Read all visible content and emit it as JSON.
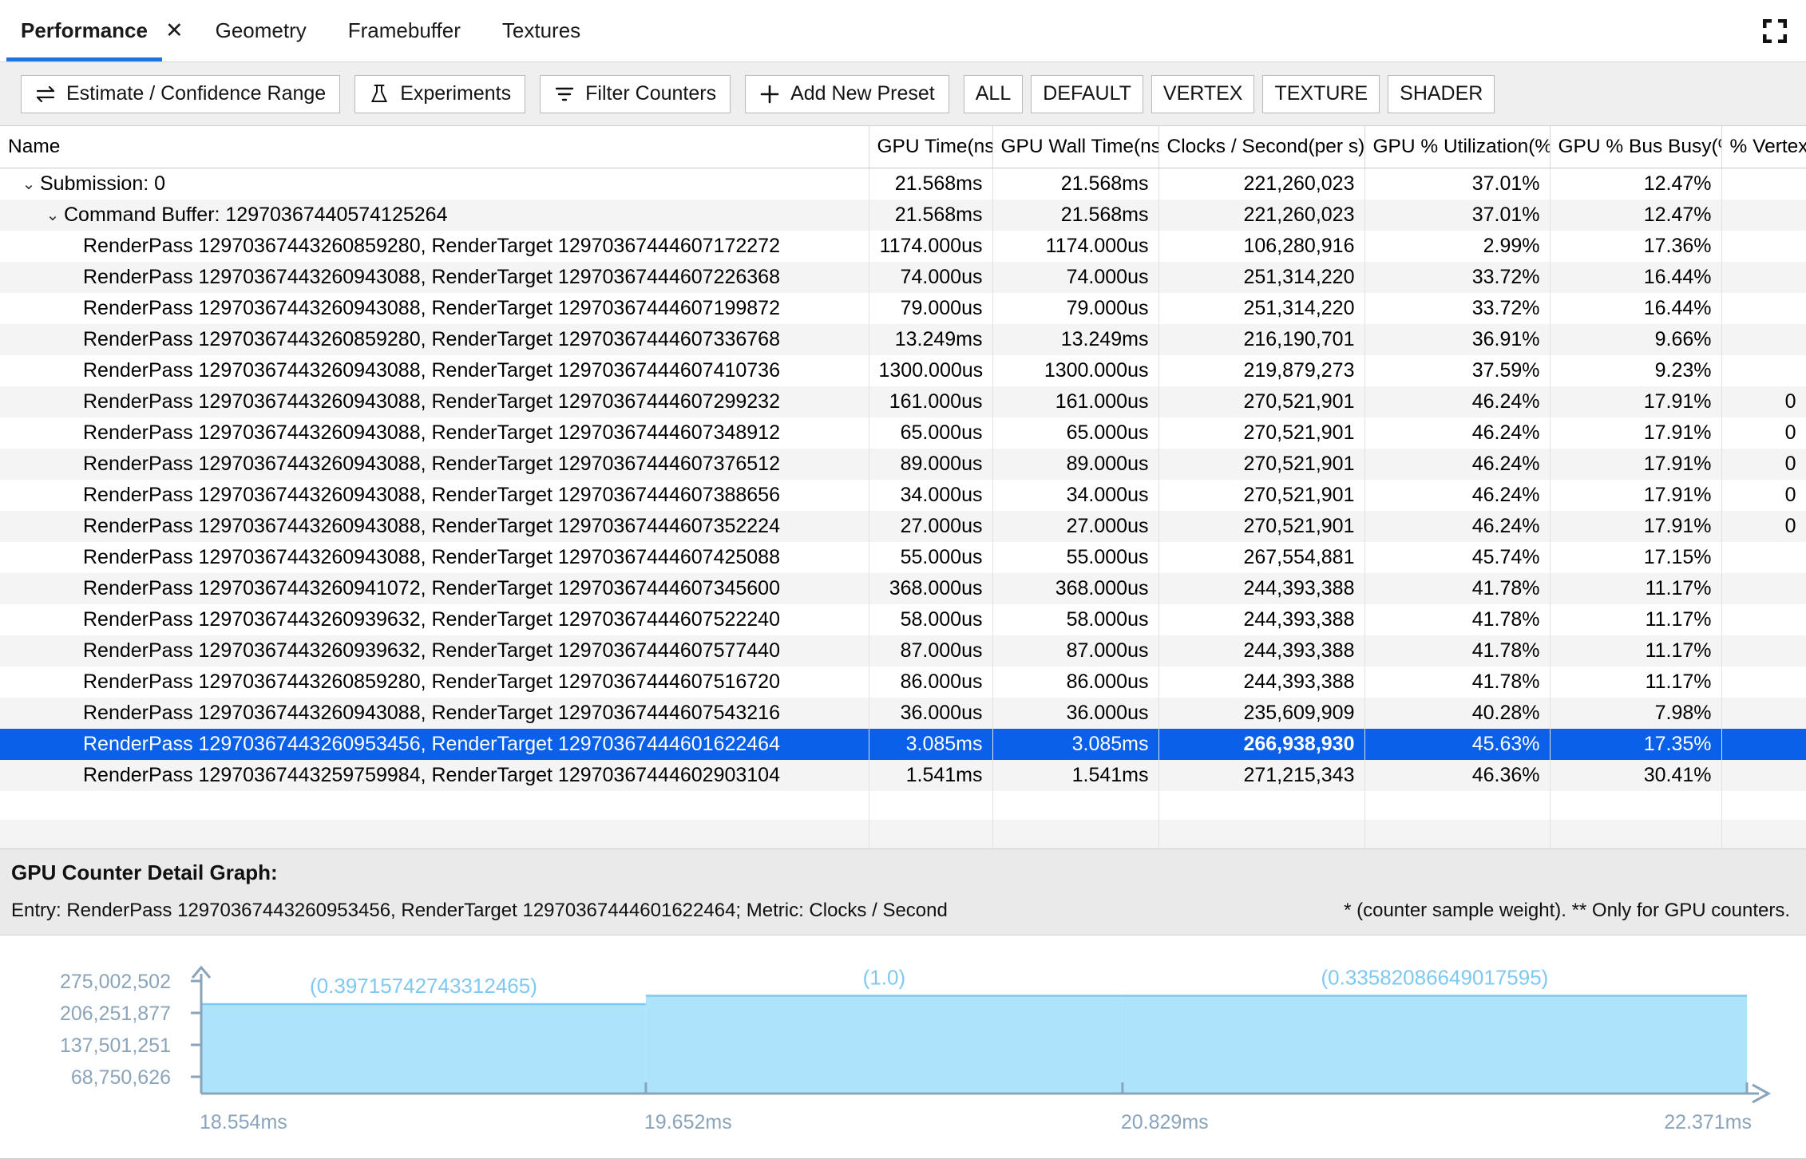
{
  "tabs": [
    {
      "label": "Performance",
      "active": true,
      "closable": true
    },
    {
      "label": "Geometry",
      "active": false,
      "closable": false
    },
    {
      "label": "Framebuffer",
      "active": false,
      "closable": false
    },
    {
      "label": "Textures",
      "active": false,
      "closable": false
    }
  ],
  "tab_close_glyph": "✕",
  "window": {
    "expand_icon": "expand-icon"
  },
  "toolbar": {
    "buttons": [
      {
        "label": "Estimate / Confidence Range",
        "icon": "swap-arrows-icon"
      },
      {
        "label": "Experiments",
        "icon": "flask-icon"
      },
      {
        "label": "Filter Counters",
        "icon": "filter-icon"
      },
      {
        "label": "Add New Preset",
        "icon": "plus-icon"
      }
    ],
    "presets": [
      "ALL",
      "DEFAULT",
      "VERTEX",
      "TEXTURE",
      "SHADER"
    ]
  },
  "table": {
    "columns": [
      "Name",
      "GPU Time(ns)",
      "GPU Wall Time(ns)",
      "Clocks / Second(per s)",
      "GPU % Utilization(%)",
      "GPU % Bus Busy(%)",
      "% Vertex"
    ],
    "rows": [
      {
        "name": "Submission: 0",
        "indent": 0,
        "twisty": "⌄",
        "gpu_time": "21.568ms",
        "gpu_wall_time": "21.568ms",
        "clocks": "221,260,023",
        "util": "37.01%",
        "bus": "12.47%",
        "vertex": "",
        "selected": false
      },
      {
        "name": "Command Buffer: 12970367440574125264",
        "indent": 1,
        "twisty": "⌄",
        "gpu_time": "21.568ms",
        "gpu_wall_time": "21.568ms",
        "clocks": "221,260,023",
        "util": "37.01%",
        "bus": "12.47%",
        "vertex": "",
        "selected": false
      },
      {
        "name": "RenderPass 12970367443260859280, RenderTarget 12970367444607172272",
        "indent": 2,
        "twisty": "",
        "gpu_time": "1174.000us",
        "gpu_wall_time": "1174.000us",
        "clocks": "106,280,916",
        "util": "2.99%",
        "bus": "17.36%",
        "vertex": "",
        "selected": false
      },
      {
        "name": "RenderPass 12970367443260943088, RenderTarget 12970367444607226368",
        "indent": 2,
        "twisty": "",
        "gpu_time": "74.000us",
        "gpu_wall_time": "74.000us",
        "clocks": "251,314,220",
        "util": "33.72%",
        "bus": "16.44%",
        "vertex": "",
        "selected": false
      },
      {
        "name": "RenderPass 12970367443260943088, RenderTarget 12970367444607199872",
        "indent": 2,
        "twisty": "",
        "gpu_time": "79.000us",
        "gpu_wall_time": "79.000us",
        "clocks": "251,314,220",
        "util": "33.72%",
        "bus": "16.44%",
        "vertex": "",
        "selected": false
      },
      {
        "name": "RenderPass 12970367443260859280, RenderTarget 12970367444607336768",
        "indent": 2,
        "twisty": "",
        "gpu_time": "13.249ms",
        "gpu_wall_time": "13.249ms",
        "clocks": "216,190,701",
        "util": "36.91%",
        "bus": "9.66%",
        "vertex": "",
        "selected": false
      },
      {
        "name": "RenderPass 12970367443260943088, RenderTarget 12970367444607410736",
        "indent": 2,
        "twisty": "",
        "gpu_time": "1300.000us",
        "gpu_wall_time": "1300.000us",
        "clocks": "219,879,273",
        "util": "37.59%",
        "bus": "9.23%",
        "vertex": "",
        "selected": false
      },
      {
        "name": "RenderPass 12970367443260943088, RenderTarget 12970367444607299232",
        "indent": 2,
        "twisty": "",
        "gpu_time": "161.000us",
        "gpu_wall_time": "161.000us",
        "clocks": "270,521,901",
        "util": "46.24%",
        "bus": "17.91%",
        "vertex": "0",
        "selected": false
      },
      {
        "name": "RenderPass 12970367443260943088, RenderTarget 12970367444607348912",
        "indent": 2,
        "twisty": "",
        "gpu_time": "65.000us",
        "gpu_wall_time": "65.000us",
        "clocks": "270,521,901",
        "util": "46.24%",
        "bus": "17.91%",
        "vertex": "0",
        "selected": false
      },
      {
        "name": "RenderPass 12970367443260943088, RenderTarget 12970367444607376512",
        "indent": 2,
        "twisty": "",
        "gpu_time": "89.000us",
        "gpu_wall_time": "89.000us",
        "clocks": "270,521,901",
        "util": "46.24%",
        "bus": "17.91%",
        "vertex": "0",
        "selected": false
      },
      {
        "name": "RenderPass 12970367443260943088, RenderTarget 12970367444607388656",
        "indent": 2,
        "twisty": "",
        "gpu_time": "34.000us",
        "gpu_wall_time": "34.000us",
        "clocks": "270,521,901",
        "util": "46.24%",
        "bus": "17.91%",
        "vertex": "0",
        "selected": false
      },
      {
        "name": "RenderPass 12970367443260943088, RenderTarget 12970367444607352224",
        "indent": 2,
        "twisty": "",
        "gpu_time": "27.000us",
        "gpu_wall_time": "27.000us",
        "clocks": "270,521,901",
        "util": "46.24%",
        "bus": "17.91%",
        "vertex": "0",
        "selected": false
      },
      {
        "name": "RenderPass 12970367443260943088, RenderTarget 12970367444607425088",
        "indent": 2,
        "twisty": "",
        "gpu_time": "55.000us",
        "gpu_wall_time": "55.000us",
        "clocks": "267,554,881",
        "util": "45.74%",
        "bus": "17.15%",
        "vertex": "",
        "selected": false
      },
      {
        "name": "RenderPass 12970367443260941072, RenderTarget 12970367444607345600",
        "indent": 2,
        "twisty": "",
        "gpu_time": "368.000us",
        "gpu_wall_time": "368.000us",
        "clocks": "244,393,388",
        "util": "41.78%",
        "bus": "11.17%",
        "vertex": "",
        "selected": false
      },
      {
        "name": "RenderPass 12970367443260939632, RenderTarget 12970367444607522240",
        "indent": 2,
        "twisty": "",
        "gpu_time": "58.000us",
        "gpu_wall_time": "58.000us",
        "clocks": "244,393,388",
        "util": "41.78%",
        "bus": "11.17%",
        "vertex": "",
        "selected": false
      },
      {
        "name": "RenderPass 12970367443260939632, RenderTarget 12970367444607577440",
        "indent": 2,
        "twisty": "",
        "gpu_time": "87.000us",
        "gpu_wall_time": "87.000us",
        "clocks": "244,393,388",
        "util": "41.78%",
        "bus": "11.17%",
        "vertex": "",
        "selected": false
      },
      {
        "name": "RenderPass 12970367443260859280, RenderTarget 12970367444607516720",
        "indent": 2,
        "twisty": "",
        "gpu_time": "86.000us",
        "gpu_wall_time": "86.000us",
        "clocks": "244,393,388",
        "util": "41.78%",
        "bus": "11.17%",
        "vertex": "",
        "selected": false
      },
      {
        "name": "RenderPass 12970367443260943088, RenderTarget 12970367444607543216",
        "indent": 2,
        "twisty": "",
        "gpu_time": "36.000us",
        "gpu_wall_time": "36.000us",
        "clocks": "235,609,909",
        "util": "40.28%",
        "bus": "7.98%",
        "vertex": "",
        "selected": false
      },
      {
        "name": "RenderPass 12970367443260953456, RenderTarget 12970367444601622464",
        "indent": 2,
        "twisty": "",
        "gpu_time": "3.085ms",
        "gpu_wall_time": "3.085ms",
        "clocks": "266,938,930",
        "util": "45.63%",
        "bus": "17.35%",
        "vertex": "",
        "selected": true
      },
      {
        "name": "RenderPass 12970367443259759984, RenderTarget 12970367444602903104",
        "indent": 2,
        "twisty": "",
        "gpu_time": "1.541ms",
        "gpu_wall_time": "1.541ms",
        "clocks": "271,215,343",
        "util": "46.36%",
        "bus": "30.41%",
        "vertex": "",
        "selected": false
      },
      {
        "name": "",
        "indent": 2,
        "twisty": "",
        "gpu_time": "",
        "gpu_wall_time": "",
        "clocks": "",
        "util": "",
        "bus": "",
        "vertex": "",
        "selected": false
      },
      {
        "name": "",
        "indent": 2,
        "twisty": "",
        "gpu_time": "",
        "gpu_wall_time": "",
        "clocks": "",
        "util": "",
        "bus": "",
        "vertex": "",
        "selected": false
      }
    ]
  },
  "detail": {
    "title": "GPU Counter Detail Graph:",
    "entry": "Entry: RenderPass 12970367443260953456, RenderTarget 12970367444601622464; Metric: Clocks / Second",
    "note": "* (counter sample weight). ** Only for GPU counters."
  },
  "colors": {
    "accent": "#1f74e0",
    "selection": "#0a60e8",
    "chart_fill": "#ade4fb",
    "chart_stroke": "#7ec8f2",
    "axis": "#8aa4bb",
    "toolbar_bg": "#efefef",
    "row_alt": "#f4f4f4"
  },
  "chart_data": {
    "type": "area",
    "title": "GPU Counter Detail Graph",
    "xlabel": "",
    "ylabel": "Clocks / Second",
    "grid": false,
    "legend": "none",
    "y_ticks": [
      "275,002,502",
      "206,251,877",
      "137,501,251",
      "68,750,626"
    ],
    "y_tick_values": [
      275002502,
      206251877,
      137501251,
      68750626
    ],
    "ylim": [
      0,
      343753128
    ],
    "x_ticks": [
      "18.554ms",
      "19.652ms",
      "20.829ms",
      "22.371ms"
    ],
    "x_tick_values": [
      18.554,
      19.652,
      20.829,
      22.371
    ],
    "xlim": [
      18.554,
      22.371
    ],
    "x_unit": "ms",
    "segments": [
      {
        "x_start": 18.554,
        "x_end": 19.652,
        "weight_label": "(0.39715742743312465)",
        "weight": 0.39715742743312465,
        "level": 0.8
      },
      {
        "x_start": 19.652,
        "x_end": 20.829,
        "weight_label": "(1.0)",
        "weight": 1.0,
        "level": 0.875
      },
      {
        "x_start": 20.829,
        "x_end": 22.371,
        "weight_label": "(0.33582086649017595)",
        "weight": 0.33582086649017595,
        "level": 0.875
      }
    ]
  }
}
